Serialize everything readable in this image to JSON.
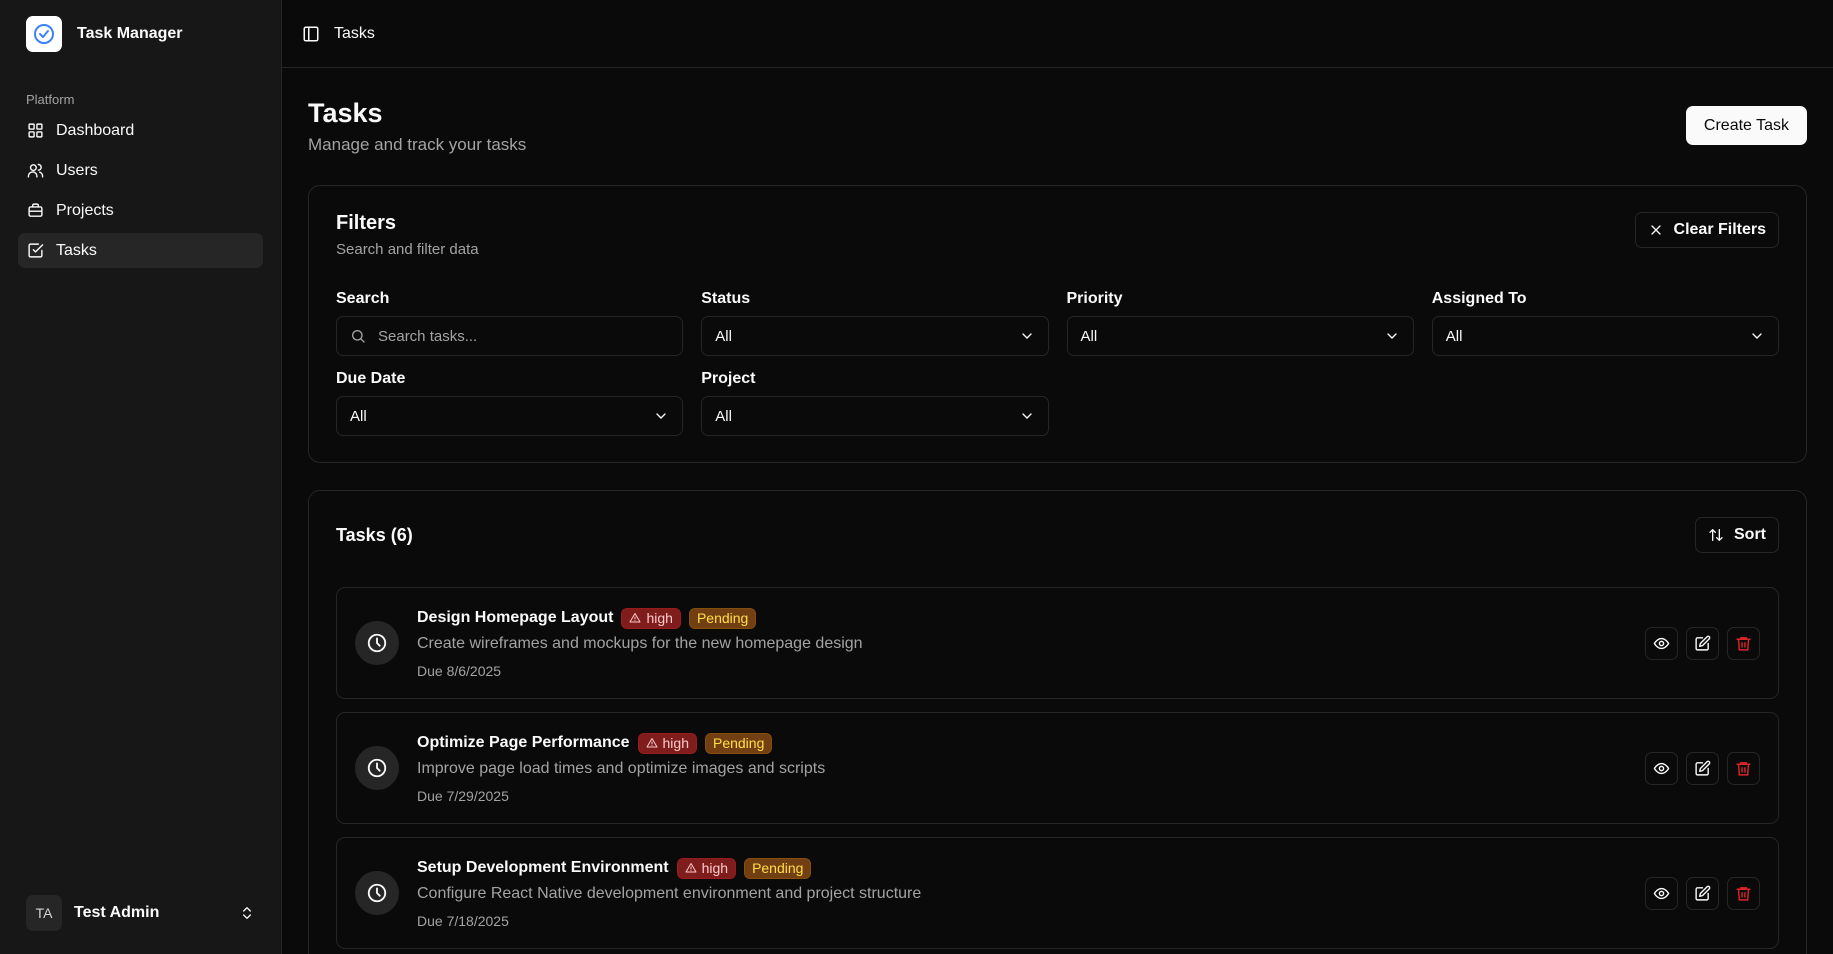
{
  "app": {
    "name": "Task Manager"
  },
  "sidebar": {
    "group_label": "Platform",
    "items": [
      {
        "label": "Dashboard",
        "icon": "grid-icon"
      },
      {
        "label": "Users",
        "icon": "users-icon"
      },
      {
        "label": "Projects",
        "icon": "briefcase-icon"
      },
      {
        "label": "Tasks",
        "icon": "checkbox-icon",
        "active": true
      }
    ],
    "user": {
      "initials": "TA",
      "name": "Test Admin"
    }
  },
  "header": {
    "breadcrumb": "Tasks"
  },
  "page": {
    "title": "Tasks",
    "subtitle": "Manage and track your tasks",
    "create_label": "Create Task"
  },
  "filters": {
    "title": "Filters",
    "subtitle": "Search and filter data",
    "clear_label": "Clear Filters",
    "search": {
      "label": "Search",
      "placeholder": "Search tasks..."
    },
    "status": {
      "label": "Status",
      "value": "All"
    },
    "priority": {
      "label": "Priority",
      "value": "All"
    },
    "assigned": {
      "label": "Assigned To",
      "value": "All"
    },
    "due_date": {
      "label": "Due Date",
      "value": "All"
    },
    "project": {
      "label": "Project",
      "value": "All"
    }
  },
  "tasks": {
    "title": "Tasks (6)",
    "sort_label": "Sort",
    "items": [
      {
        "name": "Design Homepage Layout",
        "priority": "high",
        "status": "Pending",
        "description": "Create wireframes and mockups for the new homepage design",
        "due": "Due 8/6/2025"
      },
      {
        "name": "Optimize Page Performance",
        "priority": "high",
        "status": "Pending",
        "description": "Improve page load times and optimize images and scripts",
        "due": "Due 7/29/2025"
      },
      {
        "name": "Setup Development Environment",
        "priority": "high",
        "status": "Pending",
        "description": "Configure React Native development environment and project structure",
        "due": "Due 7/18/2025"
      }
    ]
  },
  "colors": {
    "accent": "#3b82f6",
    "danger": "#dc2626",
    "pending": "#facc15"
  }
}
